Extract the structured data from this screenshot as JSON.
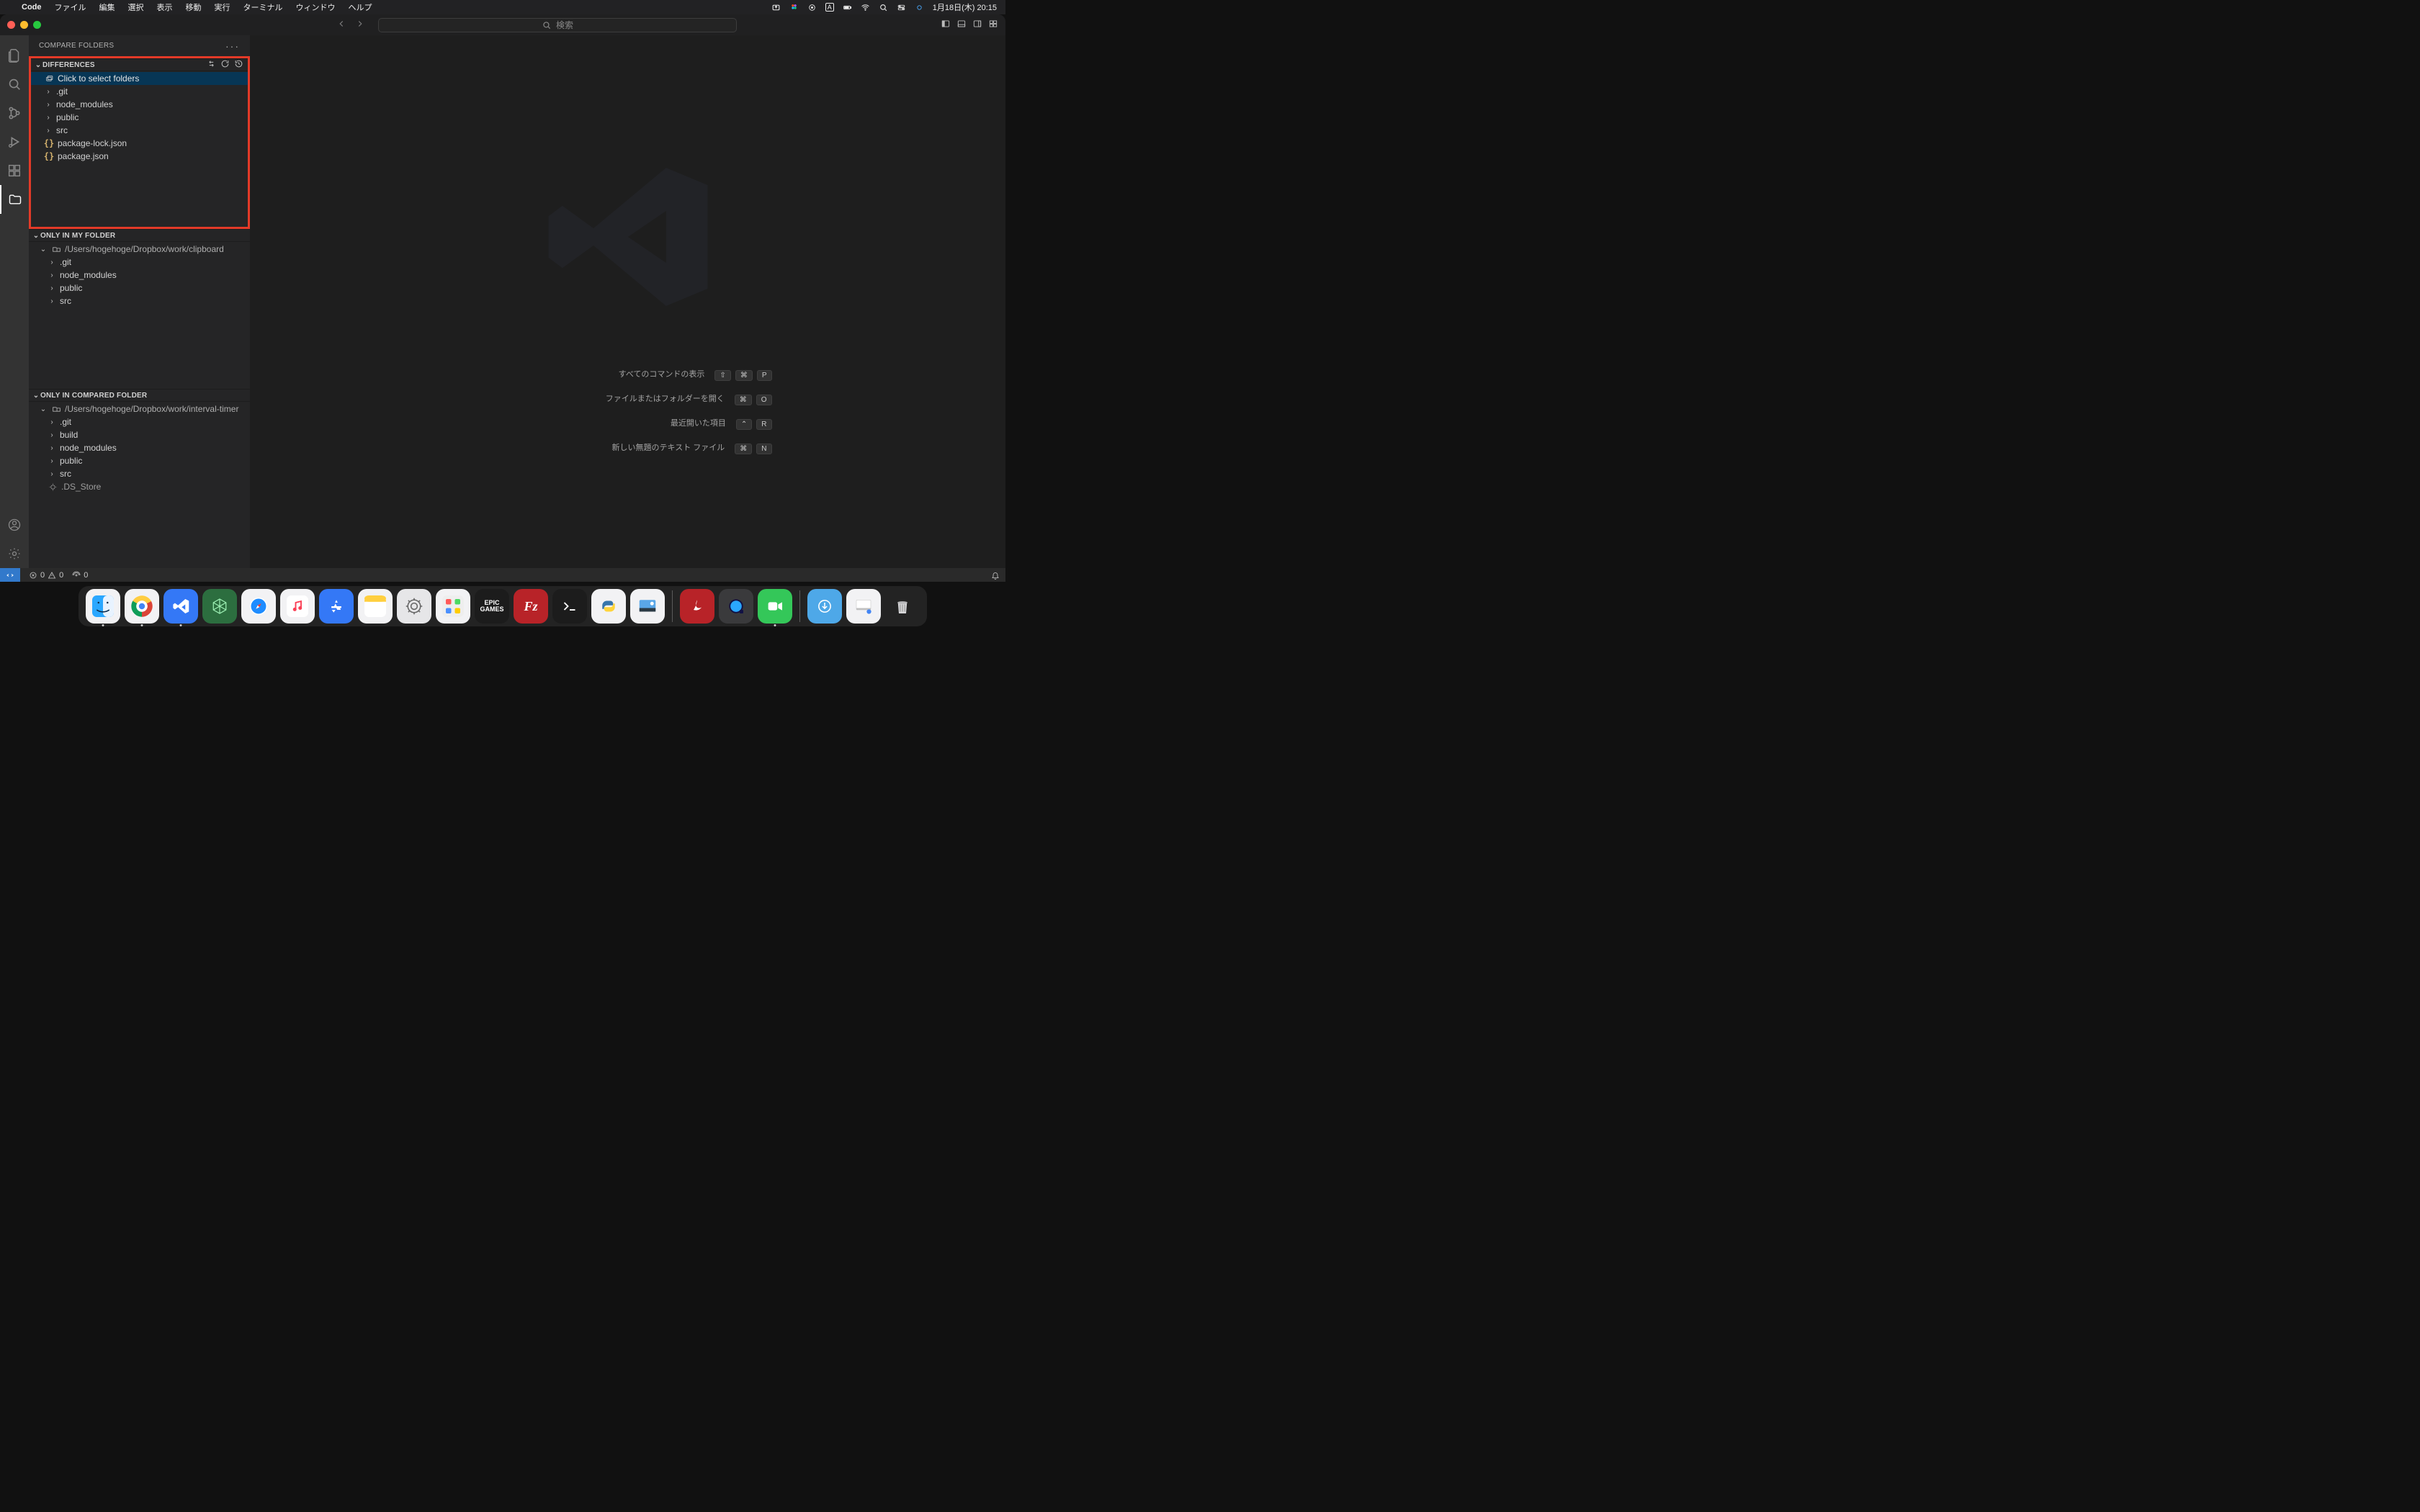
{
  "mac": {
    "app_name": "Code",
    "menus": [
      "ファイル",
      "編集",
      "選択",
      "表示",
      "移動",
      "実行",
      "ターミナル",
      "ウィンドウ",
      "ヘルプ"
    ],
    "date_time": "1月18日(木)  20:15"
  },
  "titlebar": {
    "search_placeholder": "検索"
  },
  "sidebar": {
    "title": "COMPARE FOLDERS",
    "sections": {
      "differences": {
        "label": "DIFFERENCES",
        "top_row": "Click to select folders",
        "items": [
          ".git",
          "node_modules",
          "public",
          "src",
          "package-lock.json",
          "package.json"
        ]
      },
      "only_my": {
        "label": "ONLY IN MY FOLDER",
        "path": "/Users/hogehoge/Dropbox/work/clipboard",
        "items": [
          ".git",
          "node_modules",
          "public",
          "src"
        ]
      },
      "only_compared": {
        "label": "ONLY IN COMPARED FOLDER",
        "path": "/Users/hogehoge/Dropbox/work/interval-timer",
        "items": [
          ".git",
          "build",
          "node_modules",
          "public",
          "src",
          ".DS_Store"
        ]
      }
    }
  },
  "welcome": {
    "rows": [
      {
        "label": "すべてのコマンドの表示",
        "keys": [
          "⇧",
          "⌘",
          "P"
        ]
      },
      {
        "label": "ファイルまたはフォルダーを開く",
        "keys": [
          "⌘",
          "O"
        ]
      },
      {
        "label": "最近開いた項目",
        "keys": [
          "⌃",
          "R"
        ]
      },
      {
        "label": "新しい無題のテキスト ファイル",
        "keys": [
          "⌘",
          "N"
        ]
      }
    ]
  },
  "status": {
    "errors": "0",
    "warnings": "0",
    "ports": "0"
  }
}
